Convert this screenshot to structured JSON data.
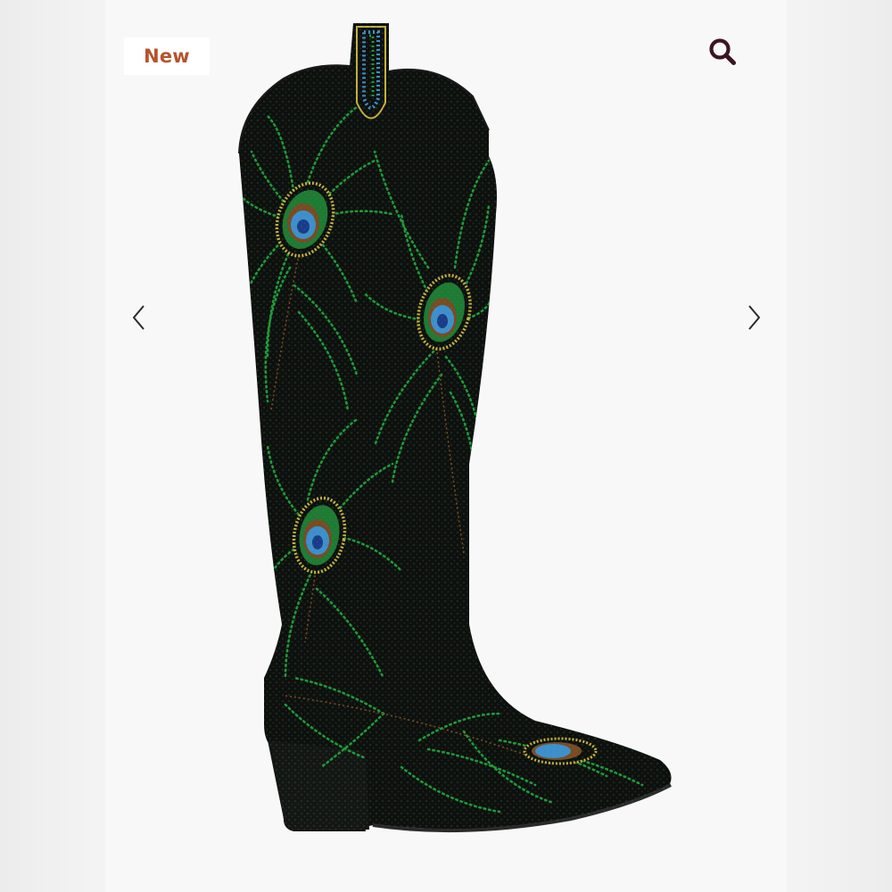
{
  "gallery": {
    "badge_label": "New",
    "icons": {
      "search": "magnifier-icon",
      "prev": "chevron-left-icon",
      "next": "chevron-right-icon"
    },
    "colors": {
      "badge_text": "#b5542c",
      "search_icon": "#3a1622",
      "boot_base": "#0f0f0f",
      "rhinestone_green": "#1f9a3a",
      "rhinestone_blue": "#3f8fd0",
      "rhinestone_gold": "#c9b13a"
    }
  }
}
